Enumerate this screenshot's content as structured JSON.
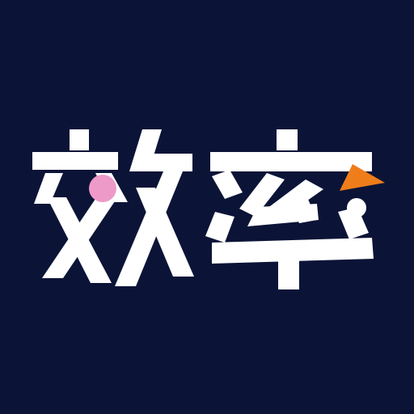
{
  "logo": {
    "word": "效率",
    "background_color": "#0b1437",
    "glyph_color": "#ffffff",
    "dot_color": "#ee9ac8",
    "triangle_color": "#ef7d1a"
  }
}
